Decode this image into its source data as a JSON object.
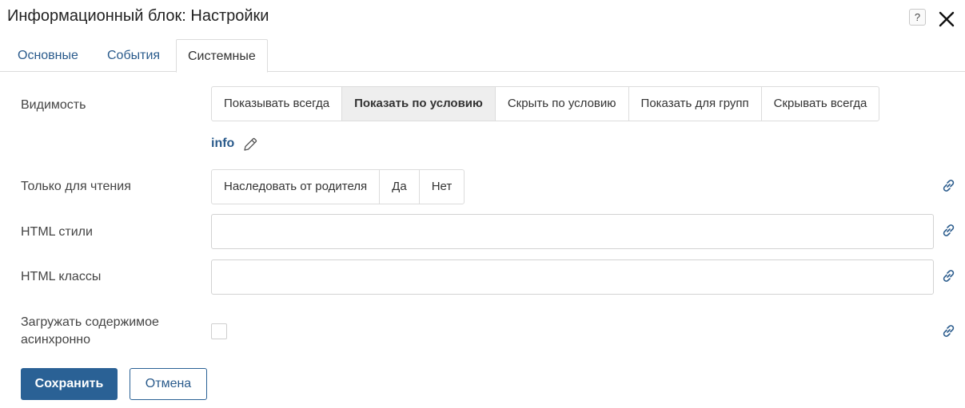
{
  "dialog": {
    "title": "Информационный блок: Настройки",
    "help_label": "?",
    "close_icon": "close-icon"
  },
  "tabs": [
    {
      "label": "Основные",
      "active": false
    },
    {
      "label": "События",
      "active": false
    },
    {
      "label": "Системные",
      "active": true
    }
  ],
  "visibility": {
    "label": "Видимость",
    "options": [
      "Показывать всегда",
      "Показать по условию",
      "Скрыть по условию",
      "Показать для групп",
      "Скрывать всегда"
    ],
    "selected": "Показать по условию",
    "condition_link": "info",
    "edit_icon": "pencil-icon"
  },
  "readonly": {
    "label": "Только для чтения",
    "options": [
      "Наследовать от родителя",
      "Да",
      "Нет"
    ]
  },
  "html_styles": {
    "label": "HTML стили",
    "value": ""
  },
  "html_classes": {
    "label": "HTML классы",
    "value": ""
  },
  "async_load": {
    "label_line1": "Загружать содержимое",
    "label_line2": "асинхронно",
    "checked": false
  },
  "link_icon": "link-icon",
  "actions": {
    "save": "Сохранить",
    "cancel": "Отмена"
  },
  "colors": {
    "accent": "#2a6195",
    "link": "#2a5b8c",
    "selected_bg": "#eeeeee",
    "border": "#dcdcdc"
  }
}
